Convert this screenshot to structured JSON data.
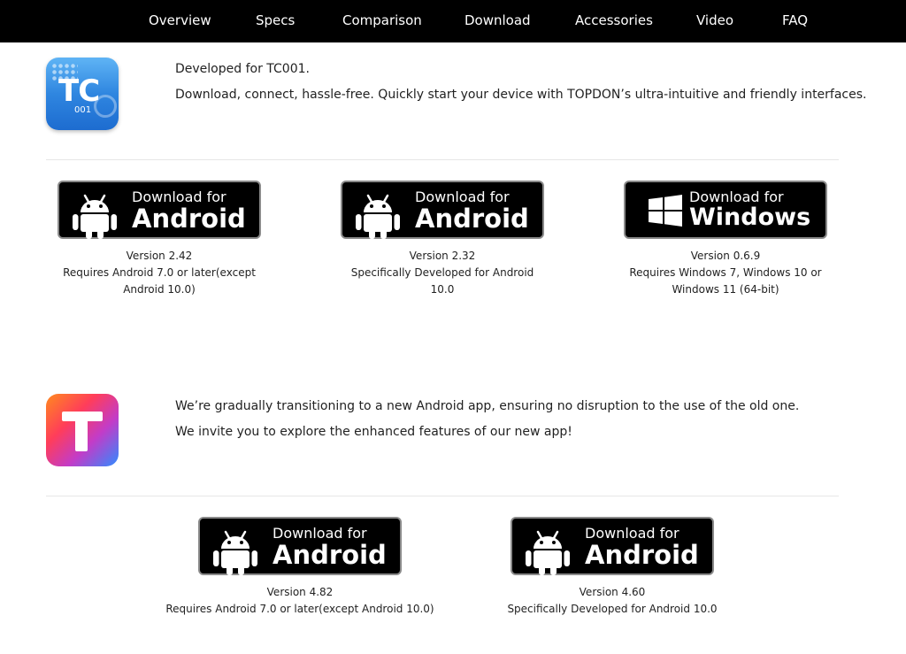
{
  "nav": {
    "items": [
      "Overview",
      "Specs",
      "Comparison",
      "Download",
      "Accessories",
      "Video",
      "FAQ"
    ]
  },
  "tc001": {
    "icon_text": "TC",
    "icon_sub": "001",
    "line1": "Developed for TC001.",
    "line2": "Download, connect, hassle-free. Quickly start your device with TOPDON’s ultra-intuitive and friendly interfaces.",
    "downloads": [
      {
        "top": "Download for",
        "platform": "Android",
        "version": "Version 2.42",
        "requirement": "Requires Android 7.0 or later(except Android 10.0)",
        "icon": "android-icon"
      },
      {
        "top": "Download for",
        "platform": "Android",
        "version": "Version 2.32",
        "requirement": "Specifically Developed for Android 10.0",
        "icon": "android-icon"
      },
      {
        "top": "Download for",
        "platform": "Windows",
        "version": "Version 0.6.9",
        "requirement": "Requires Windows 7, Windows 10 or Windows 11 (64-bit)",
        "icon": "windows-icon"
      }
    ]
  },
  "newapp": {
    "line1": "We’re gradually transitioning to a new Android app, ensuring no disruption to the use of the old one.",
    "line2": "We invite you to explore the enhanced features of our new app!",
    "downloads": [
      {
        "top": "Download for",
        "platform": "Android",
        "version": "Version 4.82",
        "requirement": "Requires Android 7.0 or later(except Android 10.0)",
        "icon": "android-icon"
      },
      {
        "top": "Download for",
        "platform": "Android",
        "version": "Version 4.60",
        "requirement": "Specifically Developed for Android 10.0",
        "icon": "android-icon"
      }
    ]
  },
  "colors": {
    "nav_bg": "#000000",
    "badge_bg": "#000000",
    "tc_icon_blue": "#2f86e0"
  }
}
